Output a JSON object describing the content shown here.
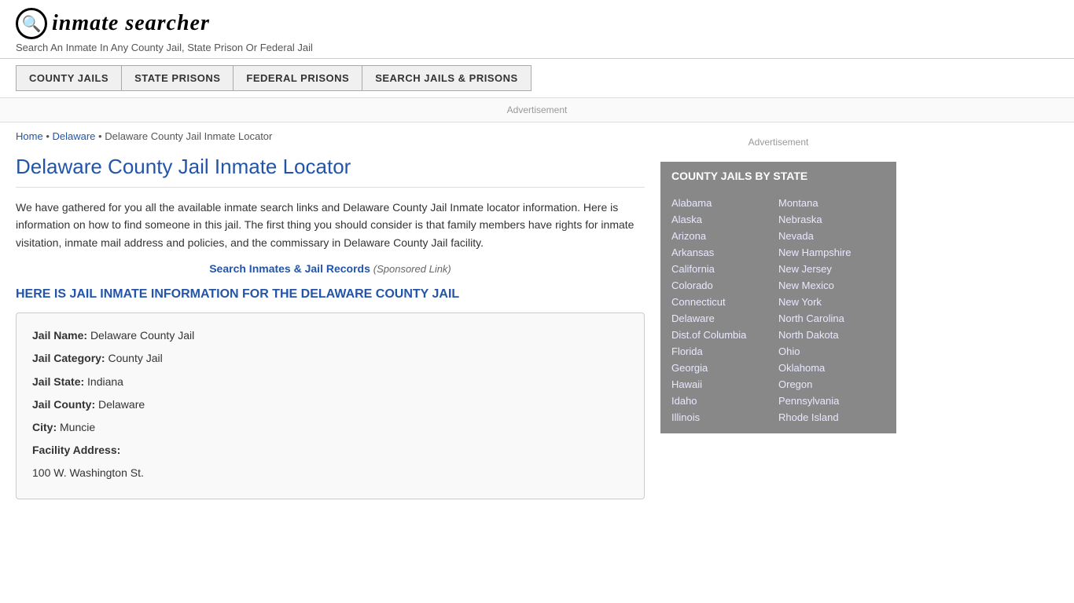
{
  "header": {
    "logo_icon": "🔍",
    "logo_text": "inmate searcher",
    "tagline": "Search An Inmate In Any County Jail, State Prison Or Federal Jail"
  },
  "nav": {
    "items": [
      {
        "label": "COUNTY JAILS"
      },
      {
        "label": "STATE PRISONS"
      },
      {
        "label": "FEDERAL PRISONS"
      },
      {
        "label": "SEARCH JAILS & PRISONS"
      }
    ]
  },
  "ad_label": "Advertisement",
  "breadcrumb": {
    "home": "Home",
    "state": "Delaware",
    "current": "Delaware County Jail Inmate Locator"
  },
  "page_title": "Delaware County Jail Inmate Locator",
  "body_text": "We have gathered for you all the available inmate search links and Delaware County Jail Inmate locator information. Here is information on how to find someone in this jail. The first thing you should consider is that family members have rights for inmate visitation, inmate mail address and policies, and the commissary in Delaware County Jail facility.",
  "sponsored": {
    "link_text": "Search Inmates & Jail Records",
    "label": "(Sponsored Link)"
  },
  "section_heading": "HERE IS JAIL INMATE INFORMATION FOR THE DELAWARE COUNTY JAIL",
  "info_box": {
    "jail_name_label": "Jail Name:",
    "jail_name_value": "Delaware County Jail",
    "jail_category_label": "Jail Category:",
    "jail_category_value": "County Jail",
    "jail_state_label": "Jail State:",
    "jail_state_value": "Indiana",
    "jail_county_label": "Jail County:",
    "jail_county_value": "Delaware",
    "city_label": "City:",
    "city_value": "Muncie",
    "facility_address_label": "Facility Address:",
    "facility_address_value": "100 W. Washington St."
  },
  "sidebar": {
    "ad_label": "Advertisement",
    "county_jails_title": "COUNTY JAILS BY STATE",
    "states_col1": [
      "Alabama",
      "Alaska",
      "Arizona",
      "Arkansas",
      "California",
      "Colorado",
      "Connecticut",
      "Delaware",
      "Dist.of Columbia",
      "Florida",
      "Georgia",
      "Hawaii",
      "Idaho",
      "Illinois"
    ],
    "states_col2": [
      "Montana",
      "Nebraska",
      "Nevada",
      "New Hampshire",
      "New Jersey",
      "New Mexico",
      "New York",
      "North Carolina",
      "North Dakota",
      "Ohio",
      "Oklahoma",
      "Oregon",
      "Pennsylvania",
      "Rhode Island"
    ]
  }
}
